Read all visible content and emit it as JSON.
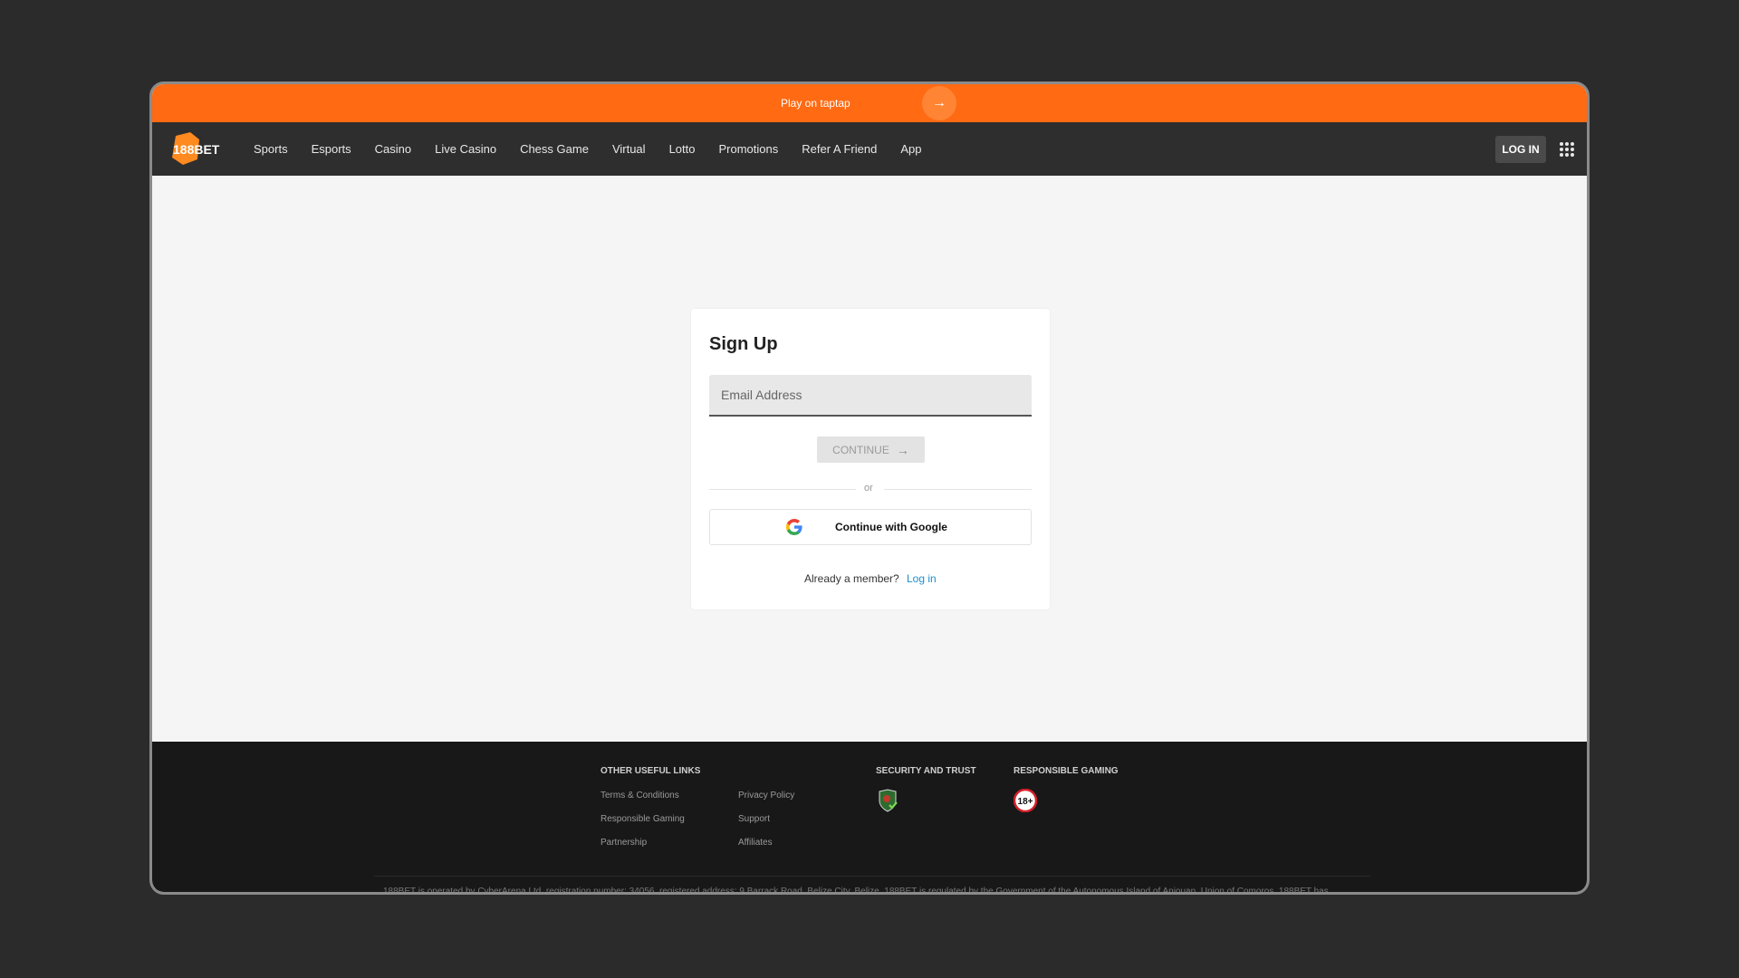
{
  "promo": {
    "text": "Play on taptap"
  },
  "nav": {
    "logo_text": "188BET",
    "items": [
      "Sports",
      "Esports",
      "Casino",
      "Live Casino",
      "Chess Game",
      "Virtual",
      "Lotto",
      "Promotions",
      "Refer A Friend",
      "App"
    ],
    "login_label": "LOG IN"
  },
  "signup": {
    "title": "Sign Up",
    "email_placeholder": "Email Address",
    "continue_label": "CONTINUE",
    "or_label": "or",
    "google_label": "Continue with Google",
    "member_text": "Already a member?",
    "login_link": "Log in"
  },
  "footer": {
    "links_heading": "OTHER USEFUL LINKS",
    "links": [
      "Terms & Conditions",
      "Privacy Policy",
      "Responsible Gaming",
      "Support",
      "Partnership",
      "Affiliates"
    ],
    "security_heading": "SECURITY AND TRUST",
    "gaming_heading": "RESPONSIBLE GAMING",
    "age_badge": "18+",
    "legal_text": "188BET is operated by CyberArena Ltd, registration number: 34056, registered address: 9 Barrack Road, Belize City, Belize. 188BET is regulated by the Government of the Autonomous Island of Anjouan, Union of Comoros. 188BET has"
  },
  "colors": {
    "brand_orange": "#ff6a13",
    "link_blue": "#1a8fcf",
    "nav_bg": "#2e2e2e",
    "footer_bg": "#181818"
  }
}
